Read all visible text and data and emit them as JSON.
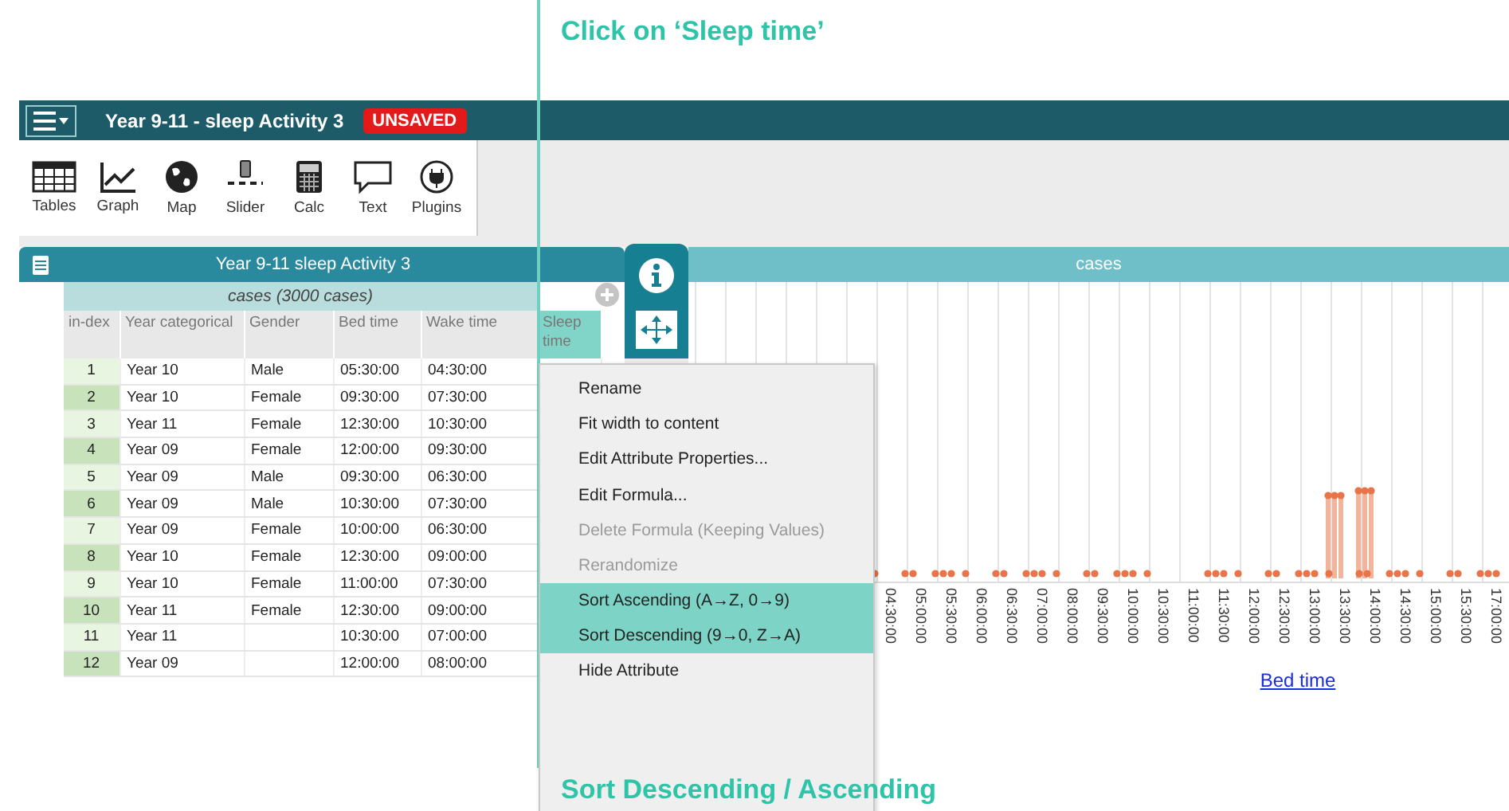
{
  "annotations": {
    "top": "Click on ‘Sleep time’",
    "bottom": "Sort Descending / Ascending"
  },
  "app_bar": {
    "title": "Year 9-11 - sleep Activity 3",
    "badge": "UNSAVED"
  },
  "toolbar": [
    {
      "label": "Tables",
      "kind": "tables"
    },
    {
      "label": "Graph",
      "kind": "graph"
    },
    {
      "label": "Map",
      "kind": "map"
    },
    {
      "label": "Slider",
      "kind": "slider"
    },
    {
      "label": "Calc",
      "kind": "calc"
    },
    {
      "label": "Text",
      "kind": "text"
    },
    {
      "label": "Plugins",
      "kind": "plugins"
    }
  ],
  "table": {
    "title": "Year 9-11 sleep Activity 3",
    "collection": "cases (3000 cases)",
    "columns": [
      {
        "label": "in-dex",
        "selected": false
      },
      {
        "label": "Year categorical",
        "selected": false
      },
      {
        "label": "Gender",
        "selected": false
      },
      {
        "label": "Bed time",
        "selected": false
      },
      {
        "label": "Wake time",
        "selected": false
      },
      {
        "label": "Sleep time",
        "selected": true
      }
    ],
    "rows": [
      [
        "1",
        "Year 10",
        "Male",
        "05:30:00",
        "04:30:00"
      ],
      [
        "2",
        "Year 10",
        "Female",
        "09:30:00",
        "07:30:00"
      ],
      [
        "3",
        "Year 11",
        "Female",
        "12:30:00",
        "10:30:00"
      ],
      [
        "4",
        "Year 09",
        "Female",
        "12:00:00",
        "09:30:00"
      ],
      [
        "5",
        "Year 09",
        "Male",
        "09:30:00",
        "06:30:00"
      ],
      [
        "6",
        "Year 09",
        "Male",
        "10:30:00",
        "07:30:00"
      ],
      [
        "7",
        "Year 09",
        "Female",
        "10:00:00",
        "06:30:00"
      ],
      [
        "8",
        "Year 10",
        "Female",
        "12:30:00",
        "09:00:00"
      ],
      [
        "9",
        "Year 10",
        "Female",
        "11:00:00",
        "07:30:00"
      ],
      [
        "10",
        "Year 11",
        "Female",
        "12:30:00",
        "09:00:00"
      ],
      [
        "11",
        "Year 11",
        "",
        "10:30:00",
        "07:00:00"
      ],
      [
        "12",
        "Year 09",
        "",
        "12:00:00",
        "08:00:00"
      ]
    ]
  },
  "menu": [
    {
      "label": "Rename",
      "disabled": false,
      "selected": false
    },
    {
      "label": "Fit width to content",
      "disabled": false,
      "selected": false
    },
    {
      "label": "Edit Attribute Properties...",
      "disabled": false,
      "selected": false
    },
    {
      "label": "Edit Formula...",
      "disabled": false,
      "selected": false
    },
    {
      "label": "Delete Formula (Keeping Values)",
      "disabled": true,
      "selected": false
    },
    {
      "label": "Rerandomize",
      "disabled": true,
      "selected": false
    },
    {
      "label": "Sort Ascending (A→Z, 0→9)",
      "disabled": false,
      "selected": true
    },
    {
      "label": "Sort Descending (9→0, Z→A)",
      "disabled": false,
      "selected": true
    },
    {
      "label": "Hide Attribute",
      "disabled": false,
      "selected": false
    }
  ],
  "graph": {
    "title": "cases",
    "x_label": "Bed time",
    "x_ticks": [
      "04:30:00",
      "05:00:00",
      "05:30:00",
      "06:00:00",
      "06:30:00",
      "07:00:00",
      "08:00:00",
      "09:30:00",
      "10:00:00",
      "10:30:00",
      "11:00:00",
      "11:30:00",
      "12:00:00",
      "12:30:00",
      "13:00:00",
      "13:30:00",
      "14:00:00",
      "14:30:00",
      "15:00:00",
      "15:30:00",
      "17:00:00"
    ]
  }
}
